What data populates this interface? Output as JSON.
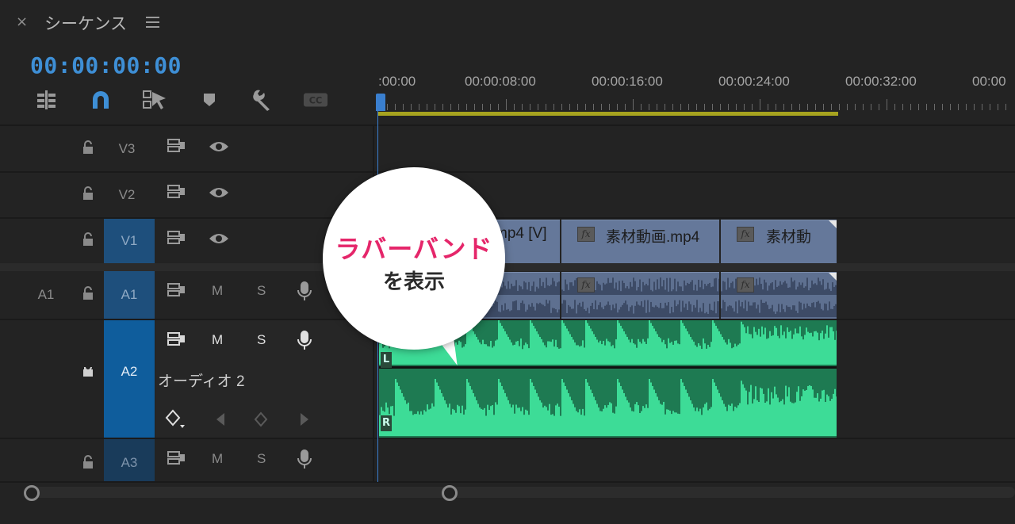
{
  "panel": {
    "close_label": "×",
    "title": "シーケンス",
    "menu_icon": "hamburger-menu-icon",
    "timecode": "00:00:00:00"
  },
  "toolbar": {
    "tools": [
      "insert-sequence-icon",
      "snap-magnet-icon",
      "linked-selection-icon",
      "add-marker-icon",
      "wrench-settings-icon",
      "captions-icon"
    ]
  },
  "ruler": {
    "labels": [
      ":00:00",
      "00:00:08:00",
      "00:00:16:00",
      "00:00:24:00",
      "00:00:32:00",
      "00:00"
    ]
  },
  "tracks": {
    "v3": {
      "label": "V3"
    },
    "v2": {
      "label": "V2"
    },
    "v1": {
      "label": "V1"
    },
    "a1": {
      "source": "A1",
      "label": "A1",
      "m": "M",
      "s": "S"
    },
    "a2": {
      "label": "A2",
      "name": "オーディオ 2",
      "m": "M",
      "s": "S"
    },
    "a3": {
      "label": "A3",
      "m": "M",
      "s": "S"
    }
  },
  "clips": {
    "v1": [
      "mp4 [V]",
      "素材動画.mp4",
      "素材動"
    ],
    "fx": "fx",
    "a2_channels": [
      "L",
      "R"
    ]
  },
  "callout": {
    "line1": "ラバーバンド",
    "line2": "を表示"
  },
  "colors": {
    "accent_blue": "#3e8fd6",
    "audio_green": "#3ddc97",
    "video_clip": "#65789a",
    "callout_pink": "#e5266a",
    "workarea": "#a7a31f"
  }
}
